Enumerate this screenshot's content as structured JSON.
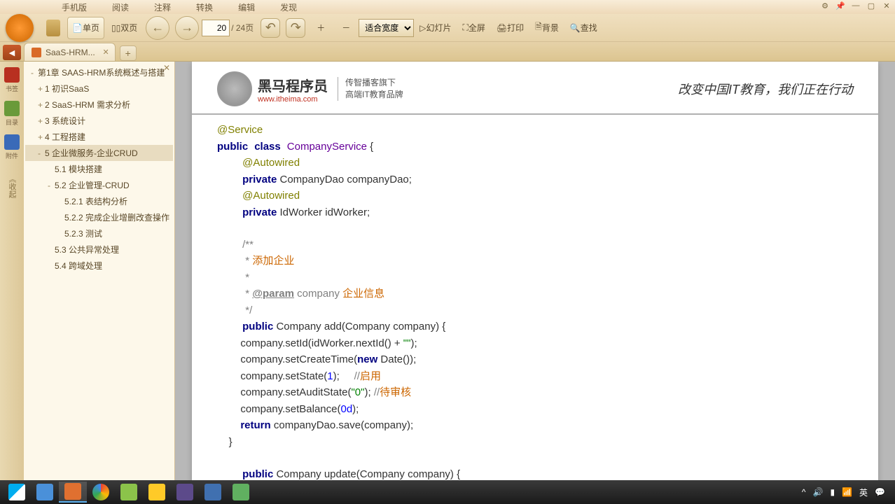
{
  "menu": [
    "手机版",
    "阅读",
    "注释",
    "转换",
    "编辑",
    "发现"
  ],
  "toolbar": {
    "single_page": "单页",
    "dual_page": "双页",
    "page_current": "20",
    "page_total": "/ 24页",
    "zoom_mode": "适合宽度",
    "slideshow": "幻灯片",
    "fullscreen": "全屏",
    "print": "打印",
    "background": "背景",
    "find": "查找"
  },
  "tab": {
    "title": "SaaS-HRM..."
  },
  "side_icons": [
    {
      "label": "书签",
      "color": "#b83020"
    },
    {
      "label": "目录",
      "color": "#6a9a3a"
    },
    {
      "label": "附件",
      "color": "#3a6ab8"
    }
  ],
  "side_vertical": "《收起",
  "outline": [
    {
      "lvl": 0,
      "exp": "-",
      "text": "第1章 SAAS-HRM系统概述与搭建"
    },
    {
      "lvl": 1,
      "exp": "+",
      "text": "1 初识SaaS"
    },
    {
      "lvl": 1,
      "exp": "+",
      "text": "2 SaaS-HRM 需求分析"
    },
    {
      "lvl": 1,
      "exp": "+",
      "text": "3 系统设计"
    },
    {
      "lvl": 1,
      "exp": "+",
      "text": "4 工程搭建"
    },
    {
      "lvl": 1,
      "exp": "-",
      "text": "5 企业微服务-企业CRUD",
      "sel": true
    },
    {
      "lvl": 2,
      "exp": "",
      "text": "5.1 模块搭建"
    },
    {
      "lvl": 2,
      "exp": "-",
      "text": "5.2 企业管理-CRUD"
    },
    {
      "lvl": 3,
      "exp": "",
      "text": "5.2.1 表结构分析"
    },
    {
      "lvl": 3,
      "exp": "",
      "text": "5.2.2 完成企业增删改查操作"
    },
    {
      "lvl": 3,
      "exp": "",
      "text": "5.2.3 测试"
    },
    {
      "lvl": 2,
      "exp": "",
      "text": "5.3 公共异常处理"
    },
    {
      "lvl": 2,
      "exp": "",
      "text": "5.4 跨域处理"
    }
  ],
  "doc_header": {
    "brand": "黑马程序员",
    "url": "www.itheima.com",
    "sub1": "传智播客旗下",
    "sub2": "高端IT教育品牌",
    "slogan": "改变中国IT教育，我们正在行动"
  },
  "code": {
    "l1_anno": "@Service",
    "l2_kw1": "public",
    "l2_kw2": "class",
    "l2_cls": "CompanyService",
    "l2_end": " {",
    "l3_anno": "@Autowired",
    "l4_kw": "private",
    "l4_rest": " CompanyDao companyDao;",
    "l5_anno": "@Autowired",
    "l6_kw": "private",
    "l6_rest": " IdWorker idWorker;",
    "l7": "/**",
    "l8a": " * ",
    "l8b": "添加企业",
    "l9": " *",
    "l10a": " * ",
    "l10b": "@param",
    "l10c": " company ",
    "l10d": "企业信息",
    "l11": " */",
    "l12_kw": "public",
    "l12_rest": " Company add(Company company) {",
    "l13a": "        company.setId(idWorker.nextId() + ",
    "l13b": "\"\"",
    "l13c": ");",
    "l14a": "        company.setCreateTime(",
    "l14b": "new",
    "l14c": " Date());",
    "l15a": "        company.setState(",
    "l15b": "1",
    "l15c": ");     ",
    "l15d": "//",
    "l15e": "启用",
    "l16a": "        company.setAuditState(",
    "l16b": "\"0\"",
    "l16c": "); ",
    "l16d": "//",
    "l16e": "待审核",
    "l17a": "        company.setBalance(",
    "l17b": "0d",
    "l17c": ");",
    "l18a": "        ",
    "l18b": "return",
    "l18c": " companyDao.save(company);",
    "l19": "    }",
    "l20_kw": "public",
    "l20_rest": " Company update(Company company) {"
  },
  "tray": {
    "ime": "英",
    "up_chevron": "^"
  }
}
